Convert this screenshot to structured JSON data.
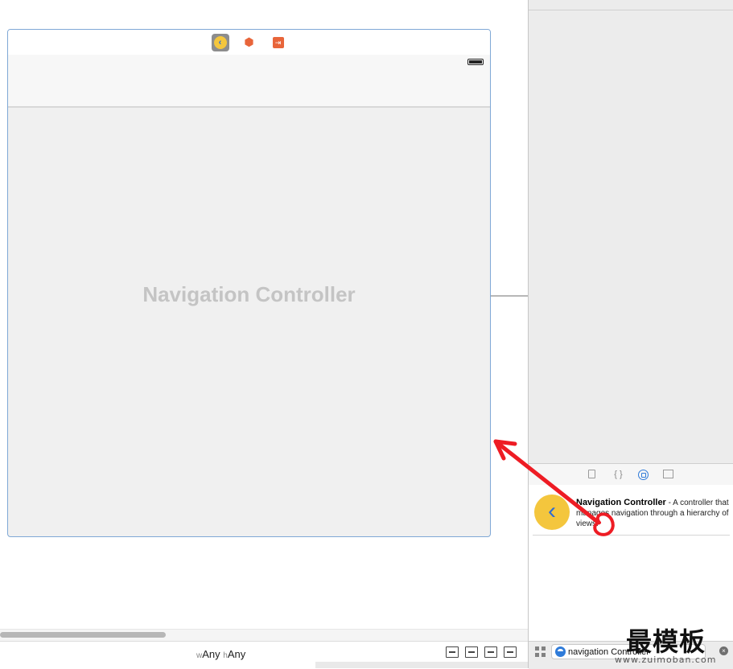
{
  "canvas": {
    "scene_title": "Navigation Controller",
    "size_class": {
      "w_prefix": "w",
      "w_value": "Any",
      "h_prefix": "h",
      "h_value": "Any"
    }
  },
  "scene_dock": {
    "icons": [
      "navigation-controller-icon",
      "first-responder-icon",
      "exit-icon"
    ],
    "nav_glyph": "‹",
    "cube_glyph": "⬢",
    "exit_glyph": "⇥"
  },
  "library": {
    "tabs": [
      "file-template-icon",
      "code-snippet-icon",
      "object-library-icon",
      "media-library-icon"
    ],
    "code_glyph": "{ }",
    "item": {
      "title": "Navigation Controller",
      "description": " - A controller that manages navigation through a hierarchy of views.",
      "glyph": "‹"
    }
  },
  "filter": {
    "value": "navigation Controller",
    "clear_glyph": "×"
  },
  "watermark": {
    "text": "最模板",
    "url": "www.zuimoban.com"
  },
  "colors": {
    "accent": "#2f7bd9",
    "annotation": "#ee1c24",
    "nav_icon_yellow": "#f4c63d",
    "dock_orange": "#e8653a"
  }
}
